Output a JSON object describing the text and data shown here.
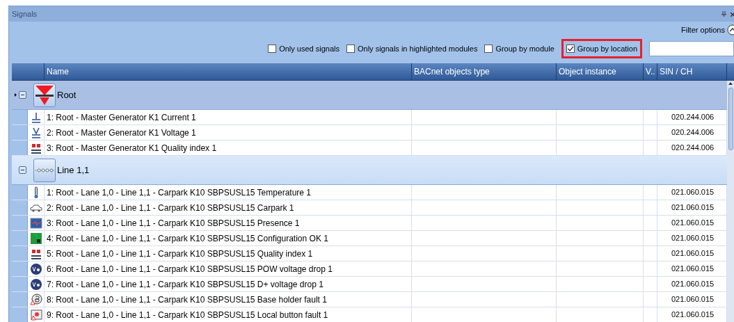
{
  "window": {
    "title": "Signals"
  },
  "filter_options": {
    "label": "Filter options",
    "expanded": true
  },
  "filters": [
    {
      "label": "Only used signals",
      "checked": false,
      "highlighted": false
    },
    {
      "label": "Only signals in highlighted modules",
      "checked": false,
      "highlighted": false
    },
    {
      "label": "Group by module",
      "checked": false,
      "highlighted": false
    },
    {
      "label": "Group by location",
      "checked": true,
      "highlighted": true
    }
  ],
  "table": {
    "columns": [
      "Name",
      "BACnet objects type",
      "Object instance",
      "V..",
      "SIN / CH"
    ],
    "groups": [
      {
        "name": "Root",
        "kind": "logo",
        "expanded": true,
        "current": true,
        "rows": [
          {
            "kind": "current",
            "name": "1: Root - Master Generator K1 Current 1",
            "sin": "020.244.006"
          },
          {
            "kind": "voltage",
            "name": "2: Root - Master Generator K1 Voltage 1",
            "sin": "020.244.006"
          },
          {
            "kind": "dup",
            "name": "3: Root - Master Generator K1 Quality index 1",
            "sin": "020.244.006"
          }
        ]
      },
      {
        "name": "Line 1,1",
        "kind": "line",
        "expanded": true,
        "current": false,
        "rows": [
          {
            "kind": "thermometer",
            "name": "1: Root - Lane 1,0 - Line 1,1 - Carpark K10 SBPSUSL15 Temperature 1",
            "sin": "021.060.015"
          },
          {
            "kind": "car",
            "name": "2: Root - Lane 1,0 - Line 1,1 - Carpark K10 SBPSUSL15 Carpark 1",
            "sin": "021.060.015"
          },
          {
            "kind": "presence",
            "name": "3: Root - Lane 1,0 - Line 1,1 - Carpark K10 SBPSUSL15 Presence 1",
            "sin": "021.060.015"
          },
          {
            "kind": "config",
            "name": "4: Root - Lane 1,0 - Line 1,1 - Carpark K10 SBPSUSL15 Configuration OK 1",
            "sin": "021.060.015"
          },
          {
            "kind": "dup",
            "name": "5: Root - Lane 1,0 - Line 1,1 - Carpark K10 SBPSUSL15 Quality index 1",
            "sin": "021.060.015"
          },
          {
            "kind": "vdc",
            "name": "6: Root - Lane 1,0 - Line 1,1 - Carpark K10 SBPSUSL15 POW voltage drop 1",
            "sin": "021.060.015"
          },
          {
            "kind": "vdc",
            "name": "7: Root - Lane 1,0 - Line 1,1 - Carpark K10 SBPSUSL15 D+ voltage drop 1",
            "sin": "021.060.015"
          },
          {
            "kind": "base-fault",
            "name": "8: Root - Lane 1,0 - Line 1,1 - Carpark K10 SBPSUSL15 Base holder fault 1",
            "sin": "021.060.015"
          },
          {
            "kind": "button-fault",
            "name": "9: Root - Lane 1,0 - Line 1,1 - Carpark K10 SBPSUSL15 Local button fault 1",
            "sin": "021.060.015"
          }
        ]
      }
    ]
  }
}
